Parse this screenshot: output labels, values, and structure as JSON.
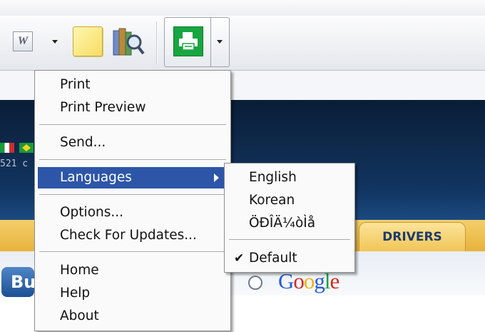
{
  "toolbar": {
    "word_icon_glyph": "W",
    "icons": [
      "word-icon",
      "chevron-down-icon",
      "note-icon",
      "books-search-icon",
      "printer-icon",
      "chevron-down-icon"
    ]
  },
  "background_page": {
    "code_text": "521 c",
    "tab_drivers": "DRIVERS",
    "buy_button_partial": "Bu",
    "search_logo": "Google"
  },
  "main_menu": {
    "items": [
      {
        "label": "Print"
      },
      {
        "label": "Print Preview"
      },
      {
        "label": "Send..."
      },
      {
        "label": "Languages"
      },
      {
        "label": "Options..."
      },
      {
        "label": "Check For Updates..."
      },
      {
        "label": "Home"
      },
      {
        "label": "Help"
      },
      {
        "label": "About"
      }
    ],
    "highlighted": "Languages"
  },
  "languages_menu": {
    "items": [
      {
        "label": "English"
      },
      {
        "label": "Korean"
      },
      {
        "label": "ÖÐÎÄ¼òÌå"
      },
      {
        "label": "Default",
        "checked": true
      }
    ],
    "check_glyph": "✔"
  },
  "colors": {
    "highlight": "#2d56a8",
    "print_icon_green": "#17a640",
    "banner_navy": "#0f2a4c",
    "tab_gold": "#f1c557"
  }
}
